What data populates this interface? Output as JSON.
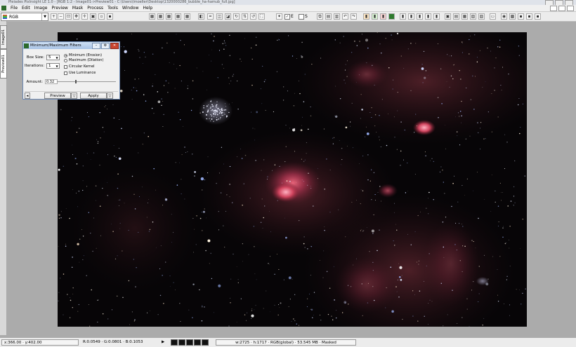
{
  "window": {
    "title": "Pleiades PixInsight LE 1.0 - [RGB 1:2 - Image01->Preview01 - C:\\Users\\lmoeller\\Desktop\\1320000286_bubble_ha-hamub_full.jpg]"
  },
  "menu": {
    "items": [
      "File",
      "Edit",
      "Image",
      "Preview",
      "Mask",
      "Process",
      "Tools",
      "Window",
      "Help"
    ]
  },
  "toolbar": {
    "channel": "RGB",
    "check_e_label": "E",
    "check_s_label": "S"
  },
  "tabs": {
    "image": "Image01",
    "preview": "Preview01"
  },
  "dialog": {
    "title": "Minimum/Maximum Filters",
    "box_size_label": "Box Size:",
    "box_size_value": "5",
    "iterations_label": "Iterations:",
    "iterations_value": "1",
    "option_min": "Minimum (Erosion)",
    "option_max": "Maximum (Dilation)",
    "circular_kernel": "Circular Kernel",
    "use_luminance": "Use Luminance",
    "amount_label": "Amount:",
    "amount_value": "0.32",
    "amount_fraction": 0.32,
    "preview_button": "Preview",
    "apply_button": "Apply"
  },
  "status": {
    "coords": "x:366.00 · y:402.00",
    "pixel_values": "R:0.0549 · G:0.0801 · B:0.1053",
    "image_info": "w:2725 · h:1717 · RGB(global) · 53.545 MB · Masked"
  },
  "colors": {
    "accent": "#6b88b3",
    "close": "#c8452f",
    "image_bg": "#070507",
    "nebula": "#c23a5a"
  }
}
